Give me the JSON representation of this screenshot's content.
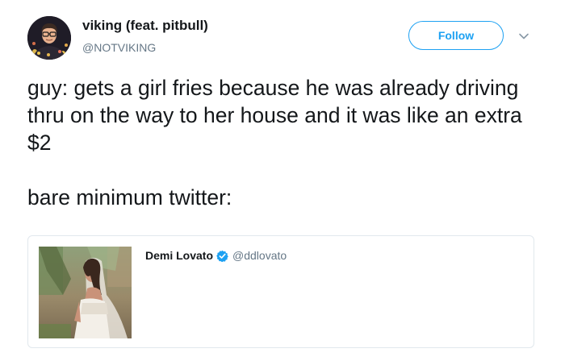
{
  "tweet": {
    "author": {
      "display_name": "viking (feat. pitbull)",
      "handle": "@NOTVIKING"
    },
    "follow_label": "Follow",
    "text_line_1": "guy: gets a girl fries because he was already driving thru on the way to her house and it was like an extra $2",
    "text_line_2": "bare minimum twitter:",
    "quoted_tweet": {
      "display_name": "Demi Lovato",
      "handle": "@ddlovato"
    }
  },
  "colors": {
    "accent": "#1da1f2",
    "text": "#14171a",
    "muted": "#657786",
    "border": "#e1e8ed"
  },
  "icons": {
    "caret": "chevron-down-icon",
    "verified": "verified-badge-icon"
  }
}
